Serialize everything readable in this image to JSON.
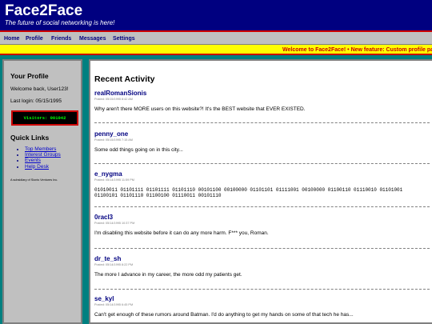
{
  "header": {
    "title": "Face2Face",
    "tagline": "The future of social networking is here!"
  },
  "nav": {
    "items": [
      {
        "label": "Home"
      },
      {
        "label": "Profile"
      },
      {
        "label": "Friends"
      },
      {
        "label": "Messages"
      },
      {
        "label": "Settings"
      }
    ]
  },
  "ticker": {
    "text": "Welcome to Face2Face! • New feature: Custom profile pag"
  },
  "sidebar": {
    "profile_heading": "Your Profile",
    "welcome": "Welcome back, User123!",
    "last_login": "Last login: 05/15/1995",
    "visitors": "Visitors: 001042",
    "quick_links_heading": "Quick Links",
    "links": [
      {
        "label": "Top Members"
      },
      {
        "label": "Interest Groups"
      },
      {
        "label": "Events"
      },
      {
        "label": "Help Desk"
      }
    ],
    "subsidiary": "A subsidiary of Sionis Ventures Inc."
  },
  "main": {
    "title": "Recent Activity",
    "posts": [
      {
        "user": "realRomanSionis",
        "date": "Posted: 05/15/1995 8:42 AM",
        "text": "Why aren't there MORE users on this website?! It's the BEST website that EVER EXISTED."
      },
      {
        "user": "penny_one",
        "date": "Posted: 05/15/1995 7:15 AM",
        "text": "Some odd things going on in this city..."
      },
      {
        "user": "e_nygma",
        "date": "Posted: 05/14/1995 11:59 PM",
        "text": "01010011 01101111 01101111 01101110 00101100 00100000 01101101 01111001 00100000 01100110 01110010 01101001 01100101 01101110 01100100 01110011 00101110"
      },
      {
        "user": "0racl3",
        "date": "Posted: 05/14/1995 10:37 PM",
        "text": "I'm disabling this website before it can do any more harm. F*** you, Roman."
      },
      {
        "user": "dr_te_sh",
        "date": "Posted: 05/14/1995 8:22 PM",
        "text": "The more I advance in my career, the more odd my patients get."
      },
      {
        "user": "se_kyl",
        "date": "Posted: 05/14/1995 6:45 PM",
        "text": "Can't get enough of these rumors around Batman. I'd do anything to get my hands on some of that tech he has..."
      }
    ]
  }
}
